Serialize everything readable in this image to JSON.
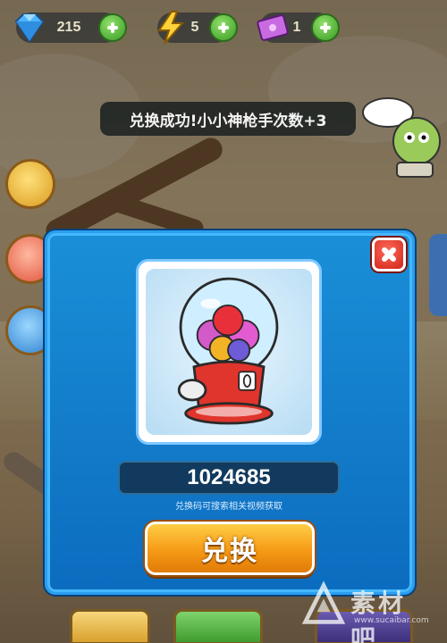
{
  "resources": {
    "gems": "215",
    "energy": "5",
    "tickets": "1"
  },
  "toast": "兑换成功!小小神枪手次数+3",
  "dialog": {
    "code_value": "1024685",
    "hint": "兑换码可搜索相关视频获取",
    "redeem_label": "兑换"
  },
  "watermark": {
    "text": "素材吧",
    "url": "www.sucaibar.com"
  },
  "colors": {
    "dialog_blue": "#0f7ccc",
    "button_orange": "#f59a16",
    "close_red": "#e0311f",
    "plus_green": "#3a9a24"
  },
  "icons": [
    "gem-icon",
    "lightning-icon",
    "ticket-icon",
    "plus-icon",
    "close-icon",
    "gumball-machine-icon"
  ]
}
